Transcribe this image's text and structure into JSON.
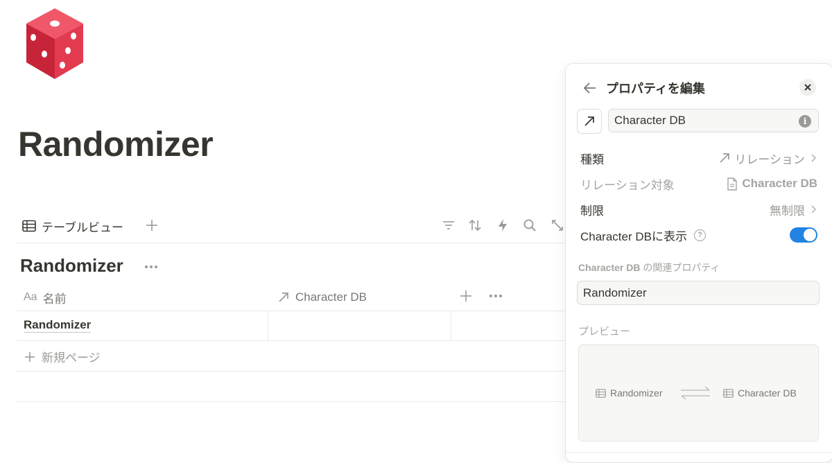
{
  "page": {
    "title": "Randomizer",
    "icon": "game-die-icon"
  },
  "viewbar": {
    "tab_label": "テーブルビュー",
    "tab_icon": "table-icon",
    "tools": [
      "filter-icon",
      "sort-icon",
      "automation-icon",
      "search-icon",
      "expand-icon"
    ]
  },
  "database": {
    "title": "Randomizer",
    "columns": [
      {
        "label": "名前",
        "type_glyph": "Aa"
      },
      {
        "label": "Character DB",
        "type_icon": "relation-arrow-icon"
      }
    ],
    "rows": [
      {
        "name": "Randomizer",
        "character_db": ""
      }
    ],
    "new_page_label": "新規ページ"
  },
  "panel": {
    "title": "プロパティを編集",
    "property_name": "Character DB",
    "type": {
      "label": "種類",
      "value": "リレーション"
    },
    "relation_target": {
      "label": "リレーション対象",
      "value": "Character DB"
    },
    "limit": {
      "label": "制限",
      "value": "無制限"
    },
    "show_in": {
      "label": "Character DBに表示",
      "enabled": true
    },
    "related_property": {
      "prefix": "Character DB",
      "suffix": " の関連プロパティ",
      "value": "Randomizer"
    },
    "preview": {
      "label": "プレビュー",
      "left": "Randomizer",
      "right": "Character DB"
    },
    "colors": {
      "toggle_on": "#2383e2",
      "die": "#e5495e"
    }
  }
}
